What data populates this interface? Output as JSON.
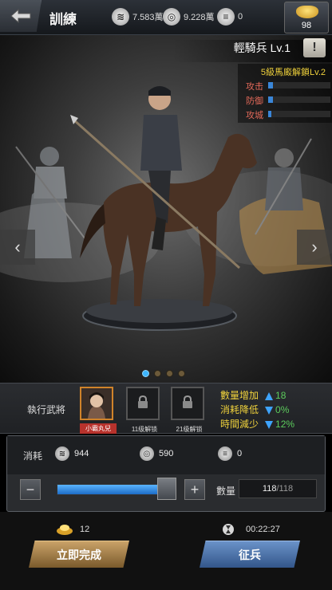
{
  "header": {
    "title": "訓練",
    "resources": [
      {
        "icon": "grain-icon",
        "value": "7.583萬"
      },
      {
        "icon": "coin-icon",
        "value": "9.228萬"
      },
      {
        "icon": "timber-icon",
        "value": "0"
      }
    ],
    "gold": "98"
  },
  "unit": {
    "name": "輕騎兵 Lv.1",
    "unlock_note": "5級馬廄解鎖Lv.2",
    "stats": [
      {
        "label": "攻击",
        "level": 0.08
      },
      {
        "label": "防御",
        "level": 0.08
      },
      {
        "label": "攻城",
        "level": 0.05
      }
    ]
  },
  "carousel": {
    "count": 4,
    "active": 0
  },
  "generals": {
    "label": "執行武將",
    "slots": [
      {
        "caption": "小霸丸兒",
        "type": "hero"
      },
      {
        "caption": "11级解锁",
        "type": "locked"
      },
      {
        "caption": "21级解锁",
        "type": "locked"
      }
    ],
    "bonuses": [
      {
        "label": "數量增加",
        "direction": "up",
        "value": "18"
      },
      {
        "label": "消耗降低",
        "direction": "down",
        "value": "0%"
      },
      {
        "label": "時間減少",
        "direction": "down",
        "value": "12%"
      }
    ]
  },
  "training": {
    "cost_label": "消耗",
    "costs": [
      {
        "icon": "grain-icon",
        "value": "944"
      },
      {
        "icon": "coin-icon",
        "value": "590"
      },
      {
        "icon": "timber-icon",
        "value": "0"
      }
    ],
    "quantity_label": "數量",
    "quantity": "118",
    "quantity_max": "/118",
    "slider_fraction": 1.0
  },
  "bottom": {
    "gold_cost": "12",
    "time": "00:22:27",
    "finish_label": "立即完成",
    "recruit_label": "征兵"
  }
}
